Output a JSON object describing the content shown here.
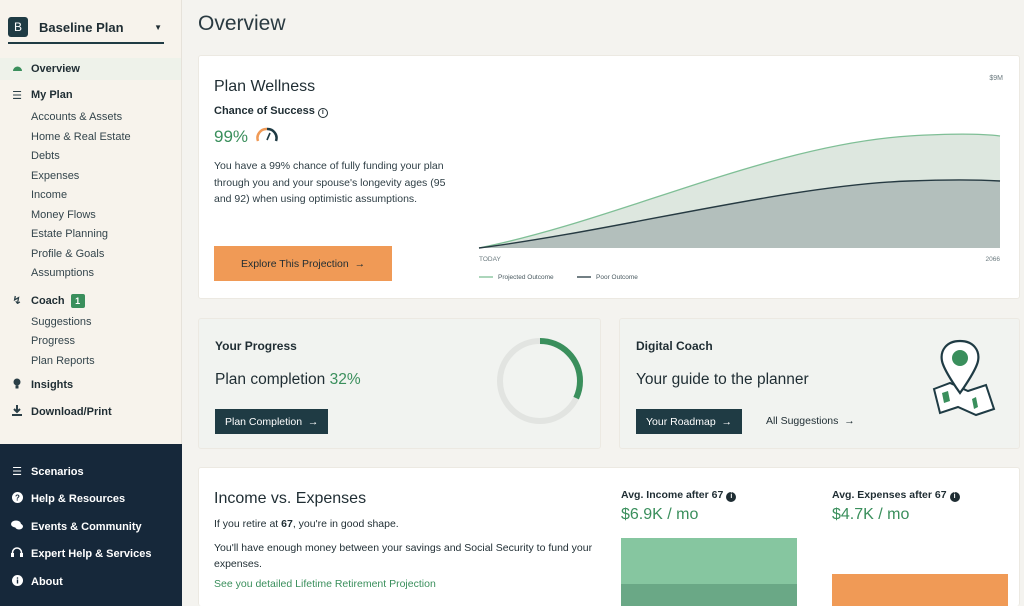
{
  "sidebar": {
    "plan_badge": "B",
    "plan_name": "Baseline Plan",
    "overview": "Overview",
    "my_plan": "My Plan",
    "my_plan_items": [
      "Accounts & Assets",
      "Home & Real Estate",
      "Debts",
      "Expenses",
      "Income",
      "Money Flows",
      "Estate Planning",
      "Profile & Goals",
      "Assumptions"
    ],
    "coach": "Coach",
    "coach_count": "1",
    "coach_items": [
      "Suggestions",
      "Progress",
      "Plan Reports"
    ],
    "insights": "Insights",
    "download": "Download/Print",
    "bottom_items": [
      "Scenarios",
      "Help & Resources",
      "Events & Community",
      "Expert Help & Services",
      "About"
    ]
  },
  "page": {
    "title": "Overview"
  },
  "wellness": {
    "title": "Plan Wellness",
    "chance_label": "Chance of Success",
    "chance_value": "99%",
    "description": "You have a 99% chance of fully funding your plan through you and your spouse's longevity ages (95 and 92) when using optimistic assumptions.",
    "button": "Explore This Projection",
    "chart_axis_top": "$9M",
    "chart_x_start": "TODAY",
    "chart_x_end": "2066",
    "legend_projected": "Projected Outcome",
    "legend_poor": "Poor Outcome"
  },
  "progress": {
    "title": "Your Progress",
    "text": "Plan completion",
    "pct_text": "32%",
    "pct_value": 0.32,
    "button": "Plan Completion"
  },
  "coach_card": {
    "title": "Digital Coach",
    "text": "Your guide to the planner",
    "button": "Your Roadmap",
    "link": "All Suggestions"
  },
  "income": {
    "title": "Income vs. Expenses",
    "line1_pre": "If you retire at ",
    "line1_age": "67",
    "line1_post": ", you're in good shape.",
    "line2": "You'll have enough money between your savings and Social Security to fund your expenses.",
    "link": "See you detailed Lifetime Retirement Projection",
    "income_label": "Avg. Income after 67",
    "income_value": "$6.9K / mo",
    "expense_label": "Avg. Expenses after 67",
    "expense_value": "$4.7K / mo"
  },
  "colors": {
    "accent_green": "#3a8f5c",
    "orange": "#f09a56",
    "navy": "#16283a",
    "dark_teal": "#1f3b44"
  },
  "icons": {
    "overview": "gauge-icon",
    "my_plan": "list-icon",
    "coach": "bolt-icon",
    "insights": "lightbulb-icon",
    "download": "download-icon",
    "scenarios": "sliders-icon",
    "help": "question-icon",
    "events": "chat-icon",
    "expert": "headset-icon",
    "about": "info-icon"
  }
}
